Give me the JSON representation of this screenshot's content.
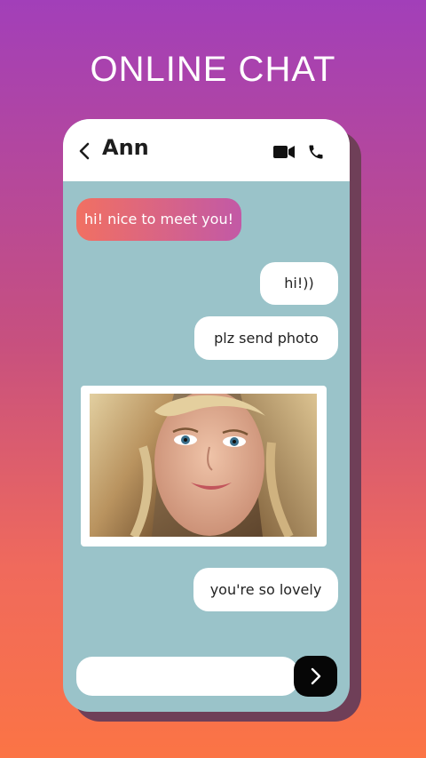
{
  "headline": "ONLINE CHAT",
  "header": {
    "contact_name": "Ann",
    "icons": {
      "back": "chevron-left-icon",
      "video": "video-camera-icon",
      "call": "phone-icon"
    }
  },
  "messages": [
    {
      "side": "incoming",
      "text": "hi! nice to meet you!"
    },
    {
      "side": "outgoing",
      "text": "hi!))"
    },
    {
      "side": "outgoing",
      "text": "plz send photo"
    },
    {
      "side": "incoming",
      "type": "photo"
    },
    {
      "side": "outgoing",
      "text": "you're so lovely"
    }
  ],
  "composer": {
    "value": "",
    "placeholder": "",
    "send_icon": "chevron-right-icon"
  },
  "colors": {
    "gradient_top": "#a23fb9",
    "gradient_bottom": "#fb7445",
    "chat_background": "#9ac3c9",
    "incoming_bubble_start": "#f17062",
    "incoming_bubble_end": "#c259a6",
    "outgoing_bubble": "#ffffff",
    "send_button": "#060606"
  }
}
